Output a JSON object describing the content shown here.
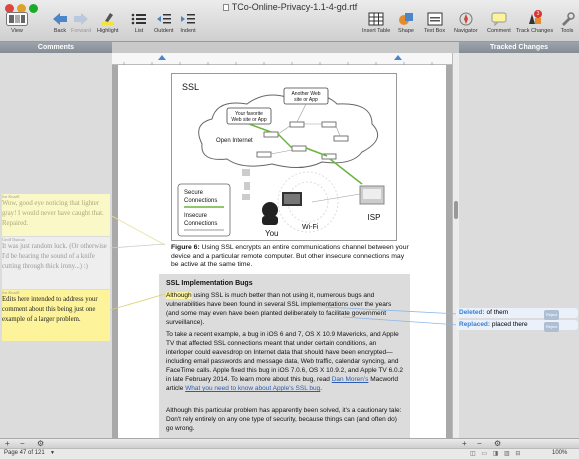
{
  "window": {
    "title": "TCo-Online-Privacy-1.1-4-gd.rtf"
  },
  "toolbar": {
    "view": "View",
    "back": "Back",
    "forward": "Forward",
    "highlight": "Highlight",
    "list": "List",
    "outdent": "Outdent",
    "indent": "Indent",
    "insert_table": "Insert Table",
    "shape": "Shape",
    "text_box": "Text Box",
    "navigator": "Navigator",
    "comment": "Comment",
    "track_changes": "Track Changes",
    "tools": "Tools",
    "track_badge": "3"
  },
  "panels": {
    "comments_header": "Comments",
    "tracked_header": "Tracked Changes"
  },
  "comments": [
    {
      "author": "Joe Kissell",
      "text": "Wow, good eye noticing that lighter gray! I would never have caught that. Repaired.",
      "bg": "#fbf8c8",
      "color": "#aaa97e"
    },
    {
      "author": "Geoff Duncan",
      "text": "It was just random luck. (Or otherwise I'd be hearing the sound of a knife cutting through thick irony...) :)",
      "bg": "#eeeeee",
      "color": "#999999"
    },
    {
      "author": "Joe Kissell",
      "text": "Edits here intended to address your comment about this being just one example of a larger problem.",
      "bg": "#fdf39b",
      "color": "#222222"
    }
  ],
  "figure": {
    "ssl": "SSL",
    "another_web": "Another Web site or App",
    "favorite_web": "Your favorite Web site or App",
    "open_internet": "Open Internet",
    "secure": "Secure Connections",
    "insecure": "Insecure Connections",
    "you": "You",
    "wifi": "Wi-Fi",
    "isp": "ISP"
  },
  "caption": {
    "bold": "Figure 6:",
    "text": " Using SSL encrypts an entire communications channel between your device and a particular remote computer. But other insecure connections may be active at the same time."
  },
  "sidebar": {
    "title": "SSL Implementation Bugs",
    "p1_prefix": "Although",
    "p1": " using SSL is much better than not using it, numerous bugs and vulnerabilities have been found in several SSL implementations over the years (and some may even have been planted deliberately to facilitate government surveillance).",
    "p2a": "To take a recent example, a bug in iOS 6 and 7, OS X 10.9 Mavericks, and Apple TV that affected SSL connections meant that under certain conditions, an interloper could eavesdrop on Internet data that should have been encrypted—including email passwords and message data, Web traffic, calendar syncing, and FaceTime calls. Apple fixed this bug in iOS 7.0.6, OS X 10.9.2, and Apple TV 6.0.2 in late February 2014. To learn more about this bug, read ",
    "p2_link1": "Dan Moren's",
    "p2b": " Macworld article ",
    "p2_link2": "What you need to know about Apple's SSL bug",
    "p2c": ".",
    "p3": "Although this particular problem has apparently been solved, it's a cautionary tale: Don't rely entirely on any one type of security, because things can (and often do) go wrong."
  },
  "tracked_changes": [
    {
      "label": "Deleted:",
      "value": "of them",
      "action": "Reject"
    },
    {
      "label": "Replaced:",
      "value": "placed there",
      "action": "Reject"
    }
  ],
  "status": {
    "page": "Page 47 of 121",
    "zoom": "100%"
  }
}
